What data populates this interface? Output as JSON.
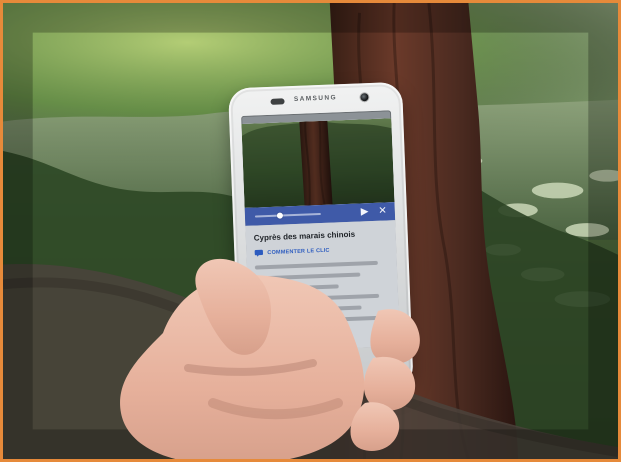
{
  "phone": {
    "brand": "SAMSUNG",
    "screen": {
      "title": "Cyprès des marais chinois",
      "comment_label": "COMMENTER LE CLIC"
    }
  },
  "icons": {
    "player_play": "play-icon",
    "player_close": "close-icon",
    "comment": "comment-icon"
  },
  "colors": {
    "frame": "#e68a3a",
    "player_bar": "#3f5aa8",
    "link": "#2c5bbf"
  }
}
